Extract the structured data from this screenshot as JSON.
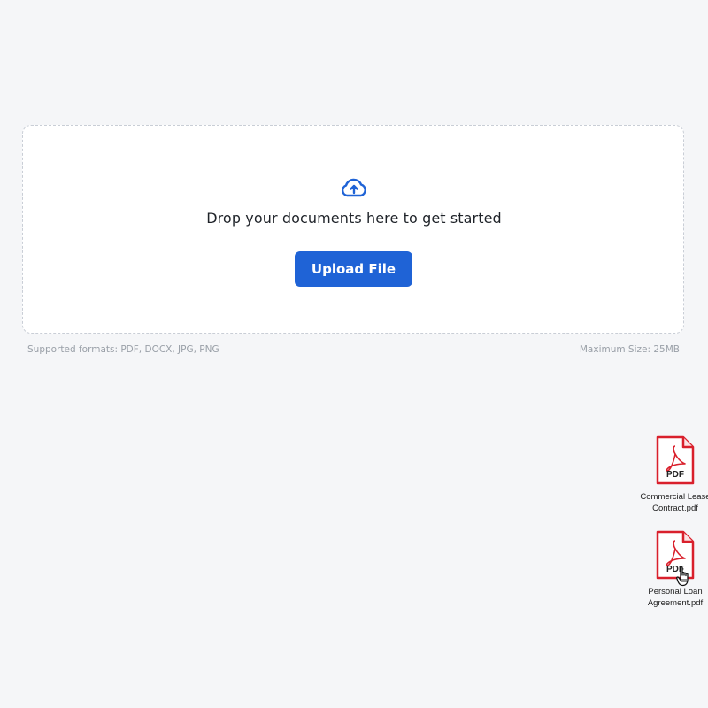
{
  "dropzone": {
    "message": "Drop your documents here to get started",
    "button_label": "Upload File",
    "upload_icon": "cloud-upload-icon"
  },
  "meta": {
    "supported_formats": "Supported formats: PDF, DOCX, JPG, PNG",
    "max_size": "Maximum Size: 25MB"
  },
  "files": [
    {
      "name": "Commercial Lease\nContract.pdf",
      "icon": "pdf-file-icon",
      "badge": "PDF"
    },
    {
      "name": "Personal Loan\nAgreement.pdf",
      "icon": "pdf-file-icon",
      "badge": "PDF"
    }
  ],
  "colors": {
    "background": "#f5f6f8",
    "accent": "#1f63d6",
    "pdf_red": "#d9202c",
    "muted_text": "#9aa0a8"
  },
  "cursor": "hand-pointer-icon"
}
